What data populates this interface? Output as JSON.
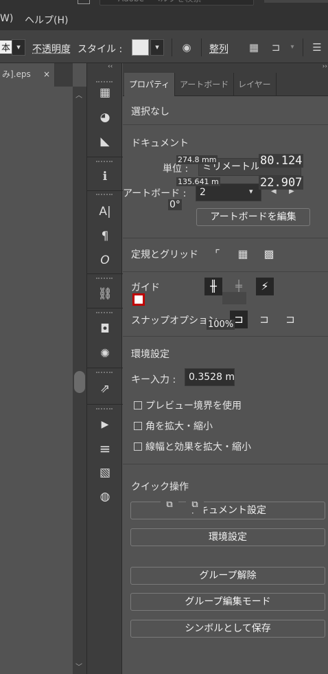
{
  "menu": {
    "items": [
      "W)",
      "ヘルプ(H)"
    ],
    "search_placeholder": "Adobe · ヘルプを検索"
  },
  "control_bar": {
    "font_value": "本",
    "opacity_label": "不透明度",
    "style_label": "スタイル :",
    "arrange_label": "整列"
  },
  "document": {
    "tab_label": "み].eps",
    "close_glyph": "×"
  },
  "tools": {
    "collapse_glyph": "‹‹",
    "items": [
      {
        "name": "artboards-panel-icon",
        "glyph": "▦"
      },
      {
        "name": "color-palette-icon",
        "glyph": "◕"
      },
      {
        "name": "gradient-wedge-icon",
        "glyph": "◣"
      },
      {
        "name": "info-icon",
        "glyph": "ℹ"
      },
      {
        "name": "character-icon",
        "glyph": "A|"
      },
      {
        "name": "paragraph-icon",
        "glyph": "¶"
      },
      {
        "name": "opentype-icon",
        "glyph": "O"
      },
      {
        "name": "links-icon",
        "glyph": "⛓"
      },
      {
        "name": "place-image-icon",
        "glyph": "◘"
      },
      {
        "name": "symbol-burst-icon",
        "glyph": "✺"
      },
      {
        "name": "export-icon",
        "glyph": "⇗"
      },
      {
        "name": "play-action-icon",
        "glyph": "▶"
      },
      {
        "name": "stroke-lines-icon",
        "glyph": "≡"
      },
      {
        "name": "gradient-panel-icon",
        "glyph": "▧"
      },
      {
        "name": "transparency-icon",
        "glyph": "◍"
      }
    ]
  },
  "properties": {
    "collapse_glyph": "››",
    "tabs": [
      "プロパティ",
      "アートボード",
      "レイヤー"
    ],
    "selection": "選択なし",
    "document_title": "ドキュメント",
    "width_value": "274.8 mm",
    "height_value": "135.641 m",
    "unit_label": "単位 :",
    "unit_value": "ミリメートル",
    "artboard_label": "アートボード :",
    "artboard_value": "2",
    "overlay_x": "80.124",
    "overlay_y": "22.907",
    "rotation_value": "0°",
    "edit_artboards_btn": "アートボードを編集",
    "rulers_grids_title": "定規とグリッド",
    "guides_title": "ガイド",
    "snap_title": "スナップオプション",
    "zoom_value": "100%",
    "preferences_title": "環境設定",
    "key_input_label": "キー入力 :",
    "key_input_value": "0.3528 m",
    "checkboxes": [
      "プレビュー境界を使用",
      "角を拡大・縮小",
      "線幅と効果を拡大・縮小"
    ],
    "quick_actions_title": "クイック操作",
    "doc_setup_btn": "ドキュメント設定",
    "prefs_btn": "環境設定",
    "ungroup_btn": "グループ解除",
    "group_edit_btn": "グループ編集モード",
    "save_symbol_btn": "シンボルとして保存"
  }
}
